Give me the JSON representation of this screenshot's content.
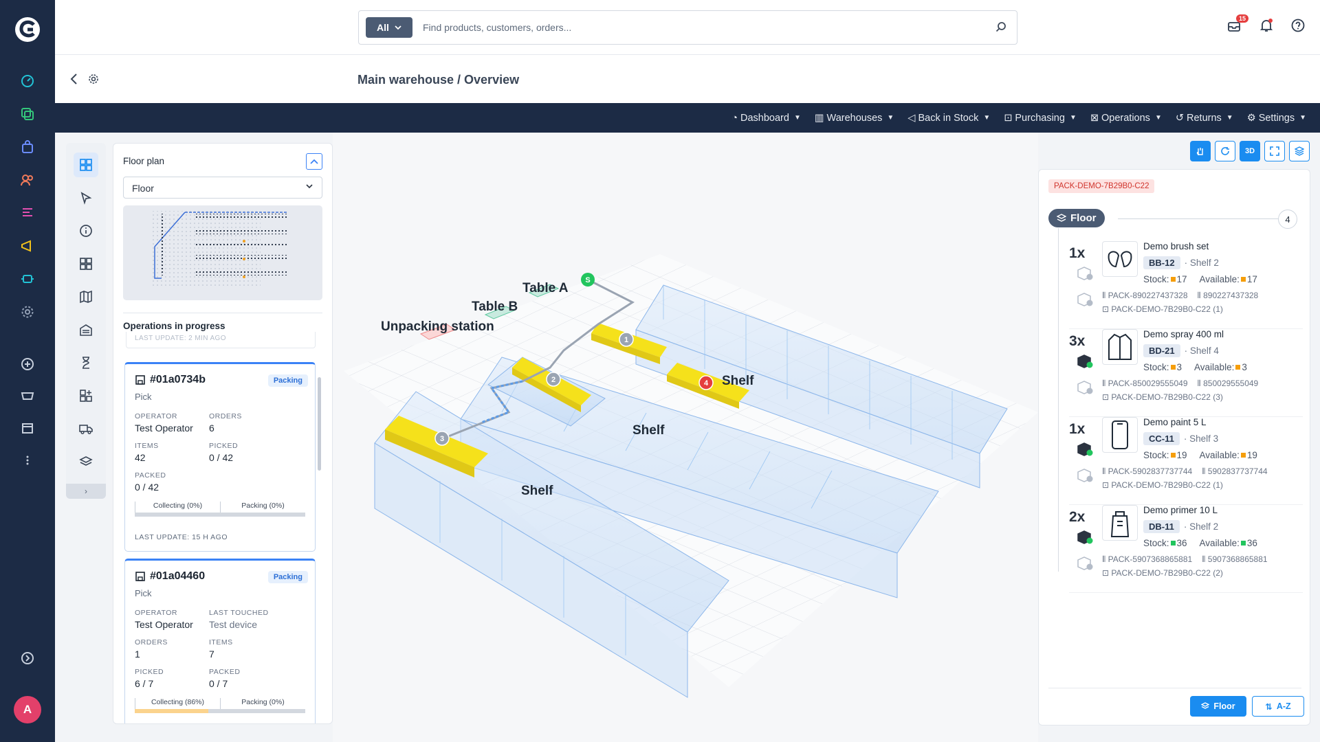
{
  "search": {
    "scope": "All",
    "placeholder": "Find products, customers, orders..."
  },
  "notifications": {
    "inbox_count": "15"
  },
  "breadcrumb": "Main warehouse / Overview",
  "nav": [
    "Dashboard",
    "Warehouses",
    "Back in Stock",
    "Purchasing",
    "Operations",
    "Returns",
    "Settings"
  ],
  "user": {
    "initial": "A"
  },
  "floorplan": {
    "title": "Floor plan",
    "select_value": "Floor"
  },
  "operations": {
    "title": "Operations in progress",
    "ghost_text": "LAST UPDATE: 2 MIN AGO",
    "cards": [
      {
        "id": "#01a0734b",
        "status": "Packing",
        "type": "Pick",
        "f1k": "OPERATOR",
        "f1v": "Test Operator",
        "f2k": "ORDERS",
        "f2v": "6",
        "f3k": "ITEMS",
        "f3v": "42",
        "f4k": "PICKED",
        "f4v": "0 / 42",
        "f5k": "PACKED",
        "f5v": "0 / 42",
        "collecting": "Collecting (0%)",
        "packing": "Packing (0%)",
        "collecting_progress": 0,
        "last_update": "LAST UPDATE: 15 H AGO"
      },
      {
        "id": "#01a04460",
        "status": "Packing",
        "type": "Pick",
        "f1k": "OPERATOR",
        "f1v": "Test Operator",
        "f2k": "LAST TOUCHED",
        "f2v": "Test device",
        "f3k": "ORDERS",
        "f3v": "1",
        "f4k": "ITEMS",
        "f4v": "7",
        "f5k": "PICKED",
        "f5v": "6 / 7",
        "f6k": "PACKED",
        "f6v": "0 / 7",
        "collecting": "Collecting (86%)",
        "packing": "Packing (0%)",
        "collecting_progress": 0.86
      }
    ]
  },
  "scene": {
    "labels": {
      "table_a": "Table A",
      "table_b": "Table B",
      "unpacking": "Unpacking station",
      "shelf1": "Shelf",
      "shelf2": "Shelf",
      "shelf3": "Shelf"
    },
    "markers": {
      "start": "S",
      "m1": "1",
      "m2": "2",
      "m3": "3",
      "m4": "4"
    },
    "view_mode": "3D"
  },
  "route": {
    "package": "PACK-DEMO-7B29B0-C22",
    "zone": "Floor",
    "zone_count": "4",
    "items": [
      {
        "qty": "1x",
        "name": "Demo brush set",
        "code": "BB-12",
        "shelf": "· Shelf 2",
        "stock": "17",
        "available": "17",
        "level": "orange",
        "pack": "PACK-890227437328",
        "ean": "890227437328",
        "order": "PACK-DEMO-7B29B0-C22 (1)",
        "icon": "gloves-icon"
      },
      {
        "qty": "3x",
        "name": "Demo spray 400 ml",
        "code": "BD-21",
        "shelf": "· Shelf 4",
        "stock": "3",
        "available": "3",
        "level": "orange",
        "pack": "PACK-850029555049",
        "ean": "850029555049",
        "order": "PACK-DEMO-7B29B0-C22 (3)",
        "icon": "jacket-icon"
      },
      {
        "qty": "1x",
        "name": "Demo paint 5 L",
        "code": "CC-11",
        "shelf": "· Shelf 3",
        "stock": "19",
        "available": "19",
        "level": "orange",
        "pack": "PACK-5902837737744",
        "ean": "5902837737744",
        "order": "PACK-DEMO-7B29B0-C22 (1)",
        "icon": "phone-icon"
      },
      {
        "qty": "2x",
        "name": "Demo primer 10 L",
        "code": "DB-11",
        "shelf": "· Shelf 2",
        "stock": "36",
        "available": "36",
        "level": "green",
        "pack": "PACK-5907368865881",
        "ean": "5907368865881",
        "order": "PACK-DEMO-7B29B0-C22 (2)",
        "icon": "bag-icon"
      }
    ],
    "btn_floor": "Floor",
    "btn_az": "A-Z"
  },
  "colors": {
    "nav_bg": "#1c2b45",
    "accent": "#1a8cf0",
    "shelf_highlight": "#f5e11b",
    "shelf_glass": "#9cc6f2"
  }
}
